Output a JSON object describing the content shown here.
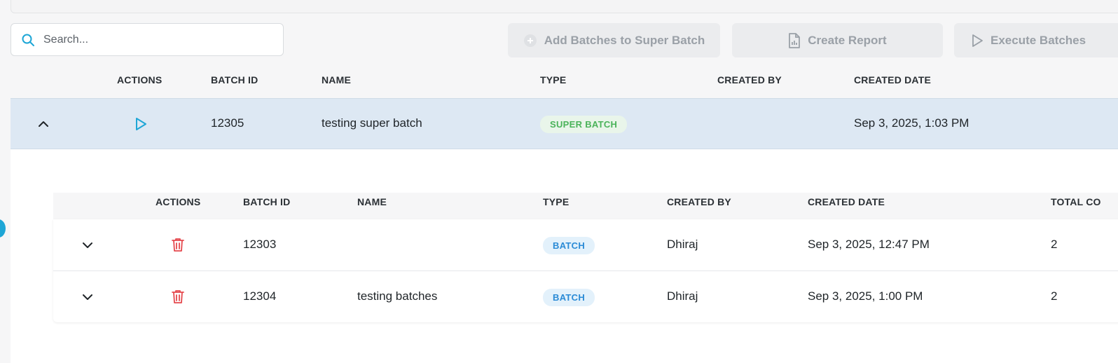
{
  "search": {
    "placeholder": "Search..."
  },
  "toolbar": {
    "add_batches_label": "Add Batches to Super Batch",
    "create_report_label": "Create Report",
    "execute_batches_label": "Execute Batches"
  },
  "table": {
    "headers": {
      "actions": "ACTIONS",
      "batch_id": "BATCH ID",
      "name": "NAME",
      "type": "TYPE",
      "created_by": "CREATED BY",
      "created_date": "CREATED DATE"
    },
    "super_row": {
      "batch_id": "12305",
      "name": "testing super batch",
      "type": "SUPER BATCH",
      "created_by": "",
      "created_date": "Sep 3, 2025, 1:03 PM"
    }
  },
  "sub_table": {
    "headers": {
      "actions": "ACTIONS",
      "batch_id": "BATCH ID",
      "name": "NAME",
      "type": "TYPE",
      "created_by": "CREATED BY",
      "created_date": "CREATED DATE",
      "total": "TOTAL CO"
    },
    "rows": [
      {
        "batch_id": "12303",
        "name": "",
        "type": "BATCH",
        "created_by": "Dhiraj",
        "created_date": "Sep 3, 2025, 12:47 PM",
        "total": "2"
      },
      {
        "batch_id": "12304",
        "name": "testing batches",
        "type": "BATCH",
        "created_by": "Dhiraj",
        "created_date": "Sep 3, 2025, 1:00 PM",
        "total": "2"
      }
    ]
  },
  "colors": {
    "accent": "#1ea6d6",
    "delete": "#e5484d",
    "super_badge": "#4bb35a",
    "batch_badge": "#2b8bd6",
    "row_highlight": "#dde8f3"
  },
  "icons": [
    "search-icon",
    "plus-circle-icon",
    "report-file-icon",
    "play-icon",
    "chevron-up-icon",
    "chevron-down-icon",
    "trash-icon"
  ]
}
